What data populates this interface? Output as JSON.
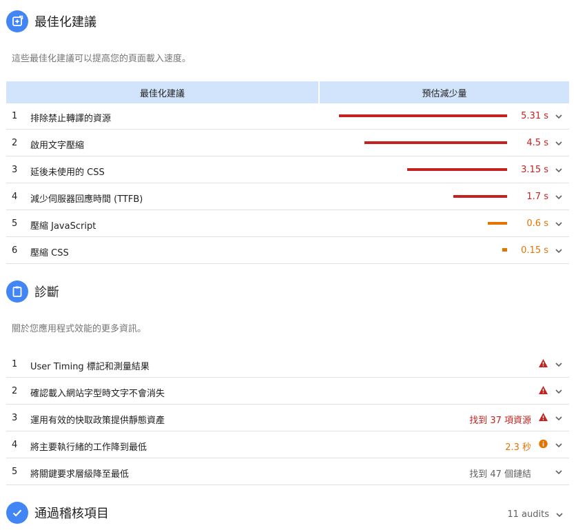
{
  "opportunities": {
    "title": "最佳化建議",
    "description": "這些最佳化建議可以提高您的頁面載入速度。",
    "col_header_1": "最佳化建議",
    "col_header_2": "預估減少量",
    "rows": [
      {
        "num": "1",
        "title": "排除禁止轉譯的資源",
        "value": "5.31 s",
        "seconds": 5.31,
        "severity": "red"
      },
      {
        "num": "2",
        "title": "啟用文字壓縮",
        "value": "4.5 s",
        "seconds": 4.5,
        "severity": "red"
      },
      {
        "num": "3",
        "title": "延後未使用的 CSS",
        "value": "3.15 s",
        "seconds": 3.15,
        "severity": "red"
      },
      {
        "num": "4",
        "title": "減少伺服器回應時間 (TTFB)",
        "value": "1.7 s",
        "seconds": 1.7,
        "severity": "red"
      },
      {
        "num": "5",
        "title": "壓縮 JavaScript",
        "value": "0.6 s",
        "seconds": 0.6,
        "severity": "orange"
      },
      {
        "num": "6",
        "title": "壓縮 CSS",
        "value": "0.15 s",
        "seconds": 0.15,
        "severity": "orange"
      }
    ]
  },
  "diagnostics": {
    "title": "診斷",
    "description": "關於您應用程式效能的更多資訊。",
    "rows": [
      {
        "num": "1",
        "title": "User Timing 標記和測量結果",
        "value": "",
        "icon": "warning-triangle-icon"
      },
      {
        "num": "2",
        "title": "確認載入網站字型時文字不會消失",
        "value": "",
        "icon": "warning-triangle-icon"
      },
      {
        "num": "3",
        "title": "運用有效的快取政策提供靜態資產",
        "value": "找到 37 項資源",
        "icon": "warning-triangle-icon"
      },
      {
        "num": "4",
        "title": "將主要執行緒的工作降到最低",
        "value": "2.3 秒",
        "icon": "info-circle-icon"
      },
      {
        "num": "5",
        "title": "將關鍵要求層級降至最低",
        "value": "找到 47 個鏈結",
        "icon": ""
      }
    ]
  },
  "passed": {
    "title": "通過稽核項目",
    "count": "11 audits"
  },
  "colors": {
    "accent": "#4285f4",
    "red": "#c5221f",
    "orange": "#e37400",
    "header_bg": "#d2e3fc"
  }
}
